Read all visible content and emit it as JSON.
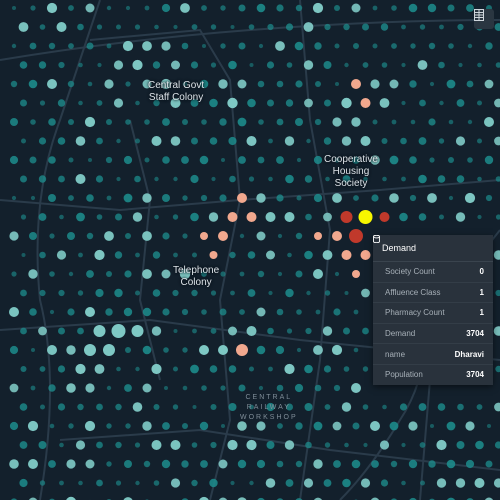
{
  "map": {
    "labels": {
      "central_govt_staff_colony": "Central Govt\nStaff Colony",
      "cooperative_housing_society": "Cooperative\nHousing\nSociety",
      "telephone_colony": "Telephone\nColony",
      "central_railway_workshop": [
        "CENTRAL",
        "RAILWAY",
        "WORKSHOP"
      ]
    },
    "layer_button_icon": "table-icon",
    "colors": {
      "background": "#13202c",
      "road": "#2a3b4a",
      "dot_low": "#1d8d8d",
      "dot_mid": "#7ec8c4",
      "dot_high": "#f1a88e",
      "dot_very_high": "#c0392b",
      "dot_max": "#f7f700"
    }
  },
  "tooltip": {
    "title": "Demand",
    "rows": [
      {
        "key": "Society Count",
        "value": "0"
      },
      {
        "key": "Affluence Class",
        "value": "1"
      },
      {
        "key": "Pharmacy Count",
        "value": "1"
      },
      {
        "key": "Demand",
        "value": "3704"
      },
      {
        "key": "name",
        "value": "Dharavi"
      },
      {
        "key": "Population",
        "value": "3704"
      }
    ]
  }
}
